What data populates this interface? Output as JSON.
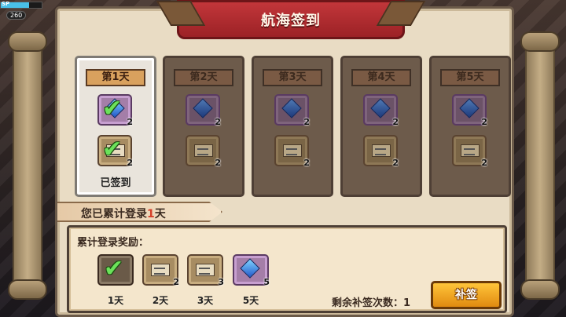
{
  "hud": {
    "sp_label": "SP",
    "number": "260"
  },
  "title": "航海签到",
  "days": [
    {
      "label": "第1天",
      "state": "signed",
      "items": [
        {
          "icon": "gem-icon",
          "count": "2"
        },
        {
          "icon": "ticket-icon",
          "count": "2"
        }
      ],
      "status": "已签到"
    },
    {
      "label": "第2天",
      "state": "locked",
      "items": [
        {
          "icon": "gem-icon",
          "count": "2"
        },
        {
          "icon": "ticket-icon",
          "count": "2"
        }
      ]
    },
    {
      "label": "第3天",
      "state": "locked",
      "items": [
        {
          "icon": "gem-icon",
          "count": "2"
        },
        {
          "icon": "ticket-icon",
          "count": "2"
        }
      ]
    },
    {
      "label": "第4天",
      "state": "locked",
      "items": [
        {
          "icon": "gem-icon",
          "count": "2"
        },
        {
          "icon": "ticket-icon",
          "count": "2"
        }
      ]
    },
    {
      "label": "第5天",
      "state": "locked",
      "items": [
        {
          "icon": "gem-icon",
          "count": "2"
        },
        {
          "icon": "ticket-icon",
          "count": "2"
        }
      ]
    }
  ],
  "cumulative": {
    "prefix": "您已累计登录",
    "days": "1",
    "suffix": "天"
  },
  "rewards": {
    "title": "累计登录奖励：",
    "items": [
      {
        "icon": "check-icon",
        "count": "",
        "label": "1天",
        "claimed": true
      },
      {
        "icon": "ticket-icon",
        "count": "2",
        "label": "2天"
      },
      {
        "icon": "ticket-icon",
        "count": "3",
        "label": "3天"
      },
      {
        "icon": "gem-icon",
        "count": "5",
        "label": "5天"
      }
    ],
    "remain_label": "剩余补签次数：",
    "remain_count": "1",
    "button_label": "补签"
  },
  "check_glyph": "✔"
}
